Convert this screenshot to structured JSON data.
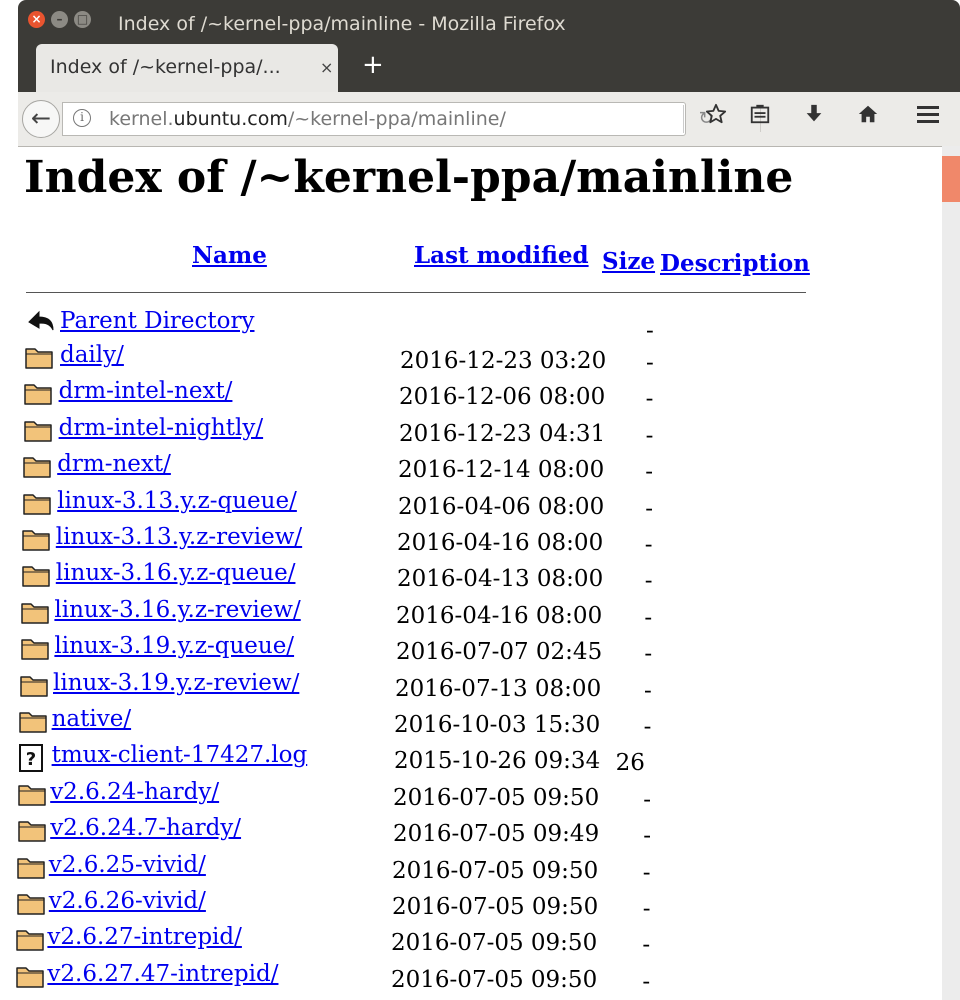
{
  "window": {
    "title": "Index of /~kernel-ppa/mainline - Mozilla Firefox",
    "close_glyph": "×",
    "min_glyph": "–",
    "max_glyph": "□"
  },
  "tab": {
    "label": "Index of /~kernel-ppa/...",
    "close_glyph": "×",
    "new_tab_glyph": "+"
  },
  "navbar": {
    "back_glyph": "←",
    "info_glyph": "i",
    "url_prefix": "kernel.",
    "url_host": "ubuntu.com",
    "url_path": "/~kernel-ppa/mainline/",
    "reload_glyph": "↻",
    "icons": [
      "star-icon",
      "reading-list-icon",
      "download-icon",
      "home-icon",
      "menu-icon"
    ]
  },
  "page": {
    "heading": "Index of /~kernel-ppa/mainline",
    "columns": {
      "name": "Name",
      "last_modified": "Last modified",
      "size": "Size",
      "description": "Description"
    },
    "parent": {
      "name": "Parent Directory",
      "size": "-"
    },
    "entries": [
      {
        "name": "daily/",
        "date": "2016-12-23 03:20",
        "size": "-",
        "icon": "folder-icon"
      },
      {
        "name": "drm-intel-next/",
        "date": "2016-12-06 08:00",
        "size": "-",
        "icon": "folder-icon"
      },
      {
        "name": "drm-intel-nightly/",
        "date": "2016-12-23 04:31",
        "size": "-",
        "icon": "folder-icon"
      },
      {
        "name": "drm-next/",
        "date": "2016-12-14 08:00",
        "size": "-",
        "icon": "folder-icon"
      },
      {
        "name": "linux-3.13.y.z-queue/",
        "date": "2016-04-06 08:00",
        "size": "-",
        "icon": "folder-icon"
      },
      {
        "name": "linux-3.13.y.z-review/",
        "date": "2016-04-16 08:00",
        "size": "-",
        "icon": "folder-icon"
      },
      {
        "name": "linux-3.16.y.z-queue/",
        "date": "2016-04-13 08:00",
        "size": "-",
        "icon": "folder-icon"
      },
      {
        "name": "linux-3.16.y.z-review/",
        "date": "2016-04-16 08:00",
        "size": "-",
        "icon": "folder-icon"
      },
      {
        "name": "linux-3.19.y.z-queue/",
        "date": "2016-07-07 02:45",
        "size": "-",
        "icon": "folder-icon"
      },
      {
        "name": "linux-3.19.y.z-review/",
        "date": "2016-07-13 08:00",
        "size": "-",
        "icon": "folder-icon"
      },
      {
        "name": "native/",
        "date": "2016-10-03 15:30",
        "size": "-",
        "icon": "folder-icon"
      },
      {
        "name": "tmux-client-17427.log",
        "date": "2015-10-26 09:34",
        "size": "26",
        "icon": "unknown-file-icon"
      },
      {
        "name": "v2.6.24-hardy/",
        "date": "2016-07-05 09:50",
        "size": "-",
        "icon": "folder-icon"
      },
      {
        "name": "v2.6.24.7-hardy/",
        "date": "2016-07-05 09:49",
        "size": "-",
        "icon": "folder-icon"
      },
      {
        "name": "v2.6.25-vivid/",
        "date": "2016-07-05 09:50",
        "size": "-",
        "icon": "folder-icon"
      },
      {
        "name": "v2.6.26-vivid/",
        "date": "2016-07-05 09:50",
        "size": "-",
        "icon": "folder-icon"
      },
      {
        "name": "v2.6.27-intrepid/",
        "date": "2016-07-05 09:50",
        "size": "-",
        "icon": "folder-icon"
      },
      {
        "name": "v2.6.27.47-intrepid/",
        "date": "2016-07-05 09:50",
        "size": "-",
        "icon": "folder-icon"
      }
    ]
  },
  "colors": {
    "link": "#0000ee",
    "titlebar": "#3c3b37",
    "scroll_thumb": "#f0886a"
  }
}
